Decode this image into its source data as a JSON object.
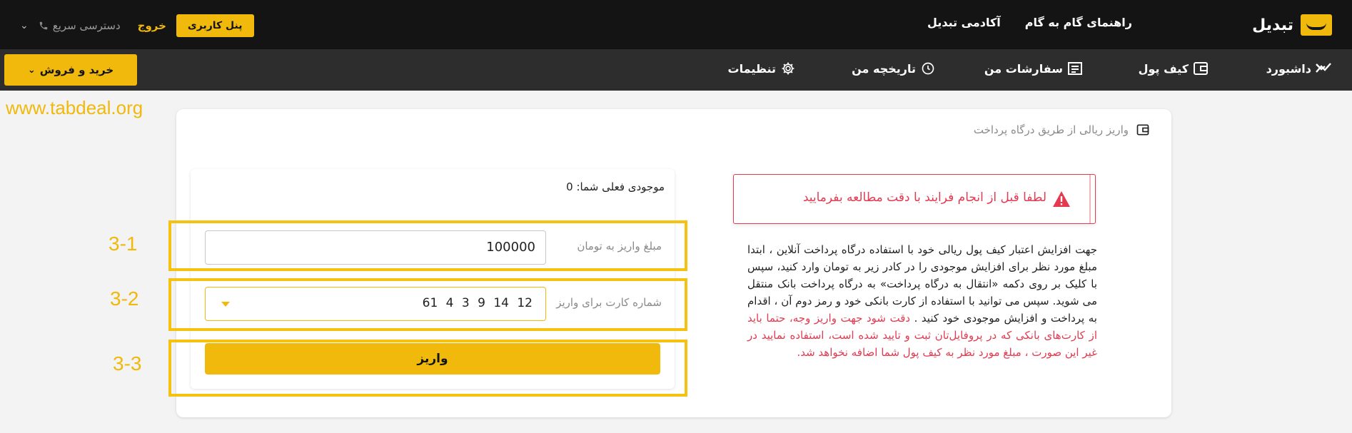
{
  "topbar": {
    "brand_name": "تبدیل",
    "links": [
      "راهنمای گام به گام",
      "آکادمی تبدیل"
    ],
    "quick_access": "دسترسی سریع",
    "logout": "خروج",
    "user_panel": "پنل کاربری"
  },
  "navbar": {
    "dashboard": "داشبورد",
    "wallet": "کیف پول",
    "orders": "سفارشات من",
    "history": "تاریخچه من",
    "settings": "تنظیمات",
    "buy_sell": "خرید و فروش"
  },
  "watermark": "www.tabdeal.org",
  "card": {
    "title": "واریز ریالی از طریق درگاه پرداخت",
    "alert": "لطفا قبل از انجام فرایند با دقت مطالعه بفرمایید",
    "desc_normal": "جهت افزایش اعتبار کیف پول ریالی خود با استفاده درگاه پرداخت آنلاین ، ابتدا مبلغ مورد نظر برای افزایش موجودی را در کادر زیر به تومان وارد کنید، سپس با کلیک بر روی دکمه «انتقال به درگاه پرداخت» به درگاه پرداخت بانک منتقل می شوید. سپس می توانید با استفاده از کارت بانکی خود و رمز دوم آن ، اقدام به پرداخت و افزایش موجودی خود کنید .",
    "desc_warning": "دقت شود جهت واریز وجه، حتما باید از کارت‌های بانکی که در پروفایل‌تان ثبت و تایید شده است، استفاده نمایید در غیر این صورت ، مبلغ مورد نظر به کیف پول شما اضافه نخواهد شد."
  },
  "form": {
    "balance_label": "موجودی فعلی شما:",
    "balance_value": "0",
    "amount_label": "مبلغ واریز به تومان",
    "amount_value": "100000",
    "card_label": "شماره کارت برای واریز",
    "card_value": "61 4 3 9 14 12",
    "submit": "واریز"
  },
  "annotations": [
    "3-1",
    "3-2",
    "3-3"
  ],
  "colors": {
    "accent": "#f0b90b",
    "danger": "#e53950",
    "topbar": "#141414",
    "navbar": "#2d2d2d"
  }
}
